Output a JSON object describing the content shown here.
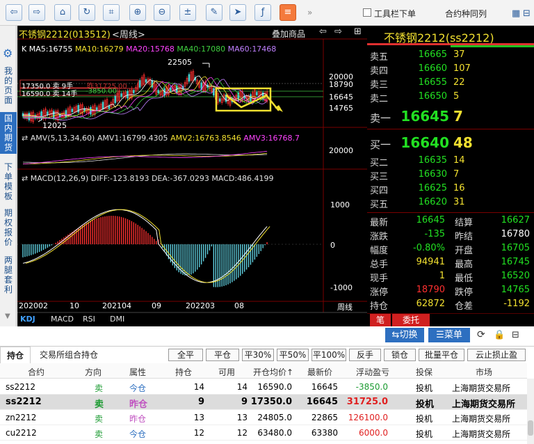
{
  "toolbar": {
    "buttons": [
      "back-icon",
      "forward-icon",
      "home-icon",
      "refresh-icon",
      "crop-icon",
      "zoom-in-icon",
      "zoom-out-icon",
      "calculator-icon",
      "pen-icon",
      "cursor-icon",
      "formula-icon",
      "menu-list-icon"
    ],
    "more": "»",
    "checkbox_label": "工具栏下单",
    "same_variety": "合约种同列",
    "colors": {
      "accent": "#f47a3c",
      "button": "#2b5d9c"
    }
  },
  "leftnav": {
    "items": [
      {
        "label": "我的页面",
        "active": false
      },
      {
        "label": "国内期货",
        "active": true
      },
      {
        "label": "下单模板",
        "active": false
      },
      {
        "label": "期权报价",
        "active": false
      },
      {
        "label": "两腿套利",
        "active": false
      }
    ]
  },
  "chart": {
    "title": "不锈钢2212(013512)",
    "period": "<周线>",
    "overlay": "叠加商品",
    "ma_line": [
      {
        "text": "K",
        "color": "#ffffff"
      },
      {
        "text": "MA5:16755",
        "color": "#ffffff"
      },
      {
        "text": "MA10:16279",
        "color": "#f2e030"
      },
      {
        "text": "MA20:15768",
        "color": "#ff44ff"
      },
      {
        "text": "MA40:17080",
        "color": "#40d040"
      },
      {
        "text": "MA60:17468",
        "color": "#c080ff"
      }
    ],
    "high_label": "22505",
    "low_label": "12025",
    "pos_label1": "17350.0 卖 9手",
    "pos_label1b": "昨31725.00",
    "pos_label2": "16590.0 卖 14手",
    "pos_label2b": "-3850.00",
    "main_axis": [
      "20000",
      "18790",
      "16645",
      "14765"
    ],
    "amv_title": "AMV(5,13,34,60)",
    "amv1": "AMV1:16799.4305",
    "amv2": "AMV2:16763.8546",
    "amv3": "AMV3:16768.7",
    "amv_axis": [
      "20000"
    ],
    "macd_title": "MACD(12,26,9)",
    "diff": "DIFF:-123.8193",
    "dea": "DEA:-367.0293",
    "macd": "MACD:486.4199",
    "macd_axis": [
      "1000",
      "0",
      "-1000"
    ],
    "x_labels": [
      "202002",
      "10",
      "202104",
      "09",
      "202203",
      "08"
    ],
    "x_unit": "周线",
    "indicator_tabs": [
      "KDJ",
      "MACD",
      "RSI",
      "DMI"
    ]
  },
  "quote": {
    "title": "不锈钢2212(ss2212)",
    "asks": [
      {
        "label": "卖五",
        "price": "16665",
        "vol": "37"
      },
      {
        "label": "卖四",
        "price": "16660",
        "vol": "107"
      },
      {
        "label": "卖三",
        "price": "16655",
        "vol": "22"
      },
      {
        "label": "卖二",
        "price": "16650",
        "vol": "5"
      },
      {
        "label": "卖一",
        "price": "16645",
        "vol": "7"
      }
    ],
    "bids": [
      {
        "label": "买一",
        "price": "16640",
        "vol": "48"
      },
      {
        "label": "买二",
        "price": "16635",
        "vol": "14"
      },
      {
        "label": "买三",
        "price": "16630",
        "vol": "7"
      },
      {
        "label": "买四",
        "price": "16625",
        "vol": "16"
      },
      {
        "label": "买五",
        "price": "16620",
        "vol": "31"
      }
    ],
    "stats": [
      {
        "l1": "最新",
        "v1": "16645",
        "c1": "#22e022",
        "l2": "结算",
        "v2": "16627",
        "c2": "#22e022"
      },
      {
        "l1": "涨跌",
        "v1": "-135",
        "c1": "#22e022",
        "l2": "昨结",
        "v2": "16780",
        "c2": "#ffffff"
      },
      {
        "l1": "幅度",
        "v1": "-0.80%",
        "c1": "#22e022",
        "l2": "开盘",
        "v2": "16705",
        "c2": "#22e022"
      },
      {
        "l1": "总手",
        "v1": "94941",
        "c1": "#f2e030",
        "l2": "最高",
        "v2": "16745",
        "c2": "#22e022"
      },
      {
        "l1": "现手",
        "v1": "1",
        "c1": "#f2e030",
        "l2": "最低",
        "v2": "16520",
        "c2": "#22e022"
      },
      {
        "l1": "涨停",
        "v1": "18790",
        "c1": "#ff3030",
        "l2": "跌停",
        "v2": "14765",
        "c2": "#22e022"
      },
      {
        "l1": "持仓",
        "v1": "62872",
        "c1": "#f2e030",
        "l2": "仓差",
        "v2": "-1192",
        "c2": "#f2e030"
      }
    ],
    "tabs": [
      "笔",
      "委托"
    ]
  },
  "midbar": {
    "switch_label": "⇆切换",
    "menu_label": "☰菜单"
  },
  "positions": {
    "tabs": [
      "持仓",
      "交易所组合持仓"
    ],
    "buttons": [
      "全平",
      "平仓",
      "平30%",
      "平50%",
      "平100%",
      "反手",
      "锁仓",
      "批量平仓",
      "云止损止盈"
    ],
    "headers": [
      "合约",
      "方向",
      "属性",
      "持仓",
      "可用",
      "开仓均价↑",
      "最新价",
      "浮动盈亏",
      "投保",
      "市场"
    ],
    "rows": [
      {
        "contract": "ss2212",
        "dir": "卖",
        "attr": "今仓",
        "hold": "14",
        "avail": "14",
        "avg": "16590.0",
        "last": "16645",
        "pnl": "-3850.0",
        "hedge": "投机",
        "market": "上海期货交易所",
        "pnl_color": "#1a9a30",
        "attr_color": "#2d6fc0",
        "bold": false,
        "sel": false
      },
      {
        "contract": "ss2212",
        "dir": "卖",
        "attr": "昨仓",
        "hold": "9",
        "avail": "9",
        "avg": "17350.0",
        "last": "16645",
        "pnl": "31725.0",
        "hedge": "投机",
        "market": "上海期货交易所",
        "pnl_color": "#e02020",
        "attr_color": "#c050c0",
        "bold": true,
        "sel": true
      },
      {
        "contract": "zn2212",
        "dir": "卖",
        "attr": "昨仓",
        "hold": "13",
        "avail": "13",
        "avg": "24805.0",
        "last": "22865",
        "pnl": "126100.0",
        "hedge": "投机",
        "market": "上海期货交易所",
        "pnl_color": "#e02020",
        "attr_color": "#c050c0",
        "bold": false,
        "sel": false
      },
      {
        "contract": "cu2212",
        "dir": "卖",
        "attr": "今仓",
        "hold": "12",
        "avail": "12",
        "avg": "63480.0",
        "last": "63380",
        "pnl": "6000.0",
        "hedge": "投机",
        "market": "上海期货交易所",
        "pnl_color": "#e02020",
        "attr_color": "#2d6fc0",
        "bold": false,
        "sel": false
      }
    ]
  }
}
